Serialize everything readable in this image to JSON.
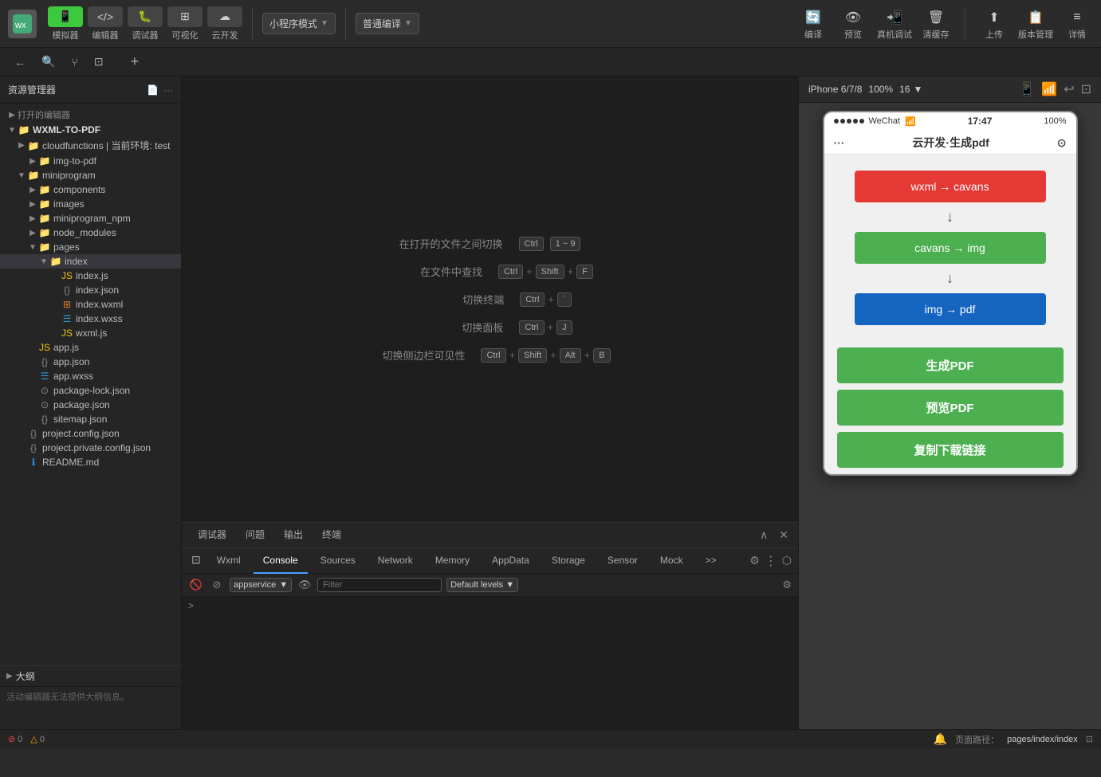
{
  "toolbar": {
    "simulator_label": "模拟器",
    "editor_label": "编辑器",
    "debugger_label": "调试器",
    "visualize_label": "可视化",
    "cloud_label": "云开发",
    "mode_label": "小程序模式",
    "compile_mode_label": "普通编译",
    "compile_btn": "编译",
    "preview_btn": "预览",
    "real_machine_label": "真机调试",
    "clean_cache_label": "清缓存",
    "upload_label": "上传",
    "version_label": "版本管理",
    "detail_label": "详情"
  },
  "sidebar": {
    "title": "资源管理器",
    "recent_label": "打开的编辑器",
    "project_name": "WXML-TO-PDF",
    "items": [
      {
        "name": "cloudfunctions | 当前环境: test",
        "type": "folder",
        "level": 1
      },
      {
        "name": "img-to-pdf",
        "type": "folder",
        "level": 2
      },
      {
        "name": "miniprogram",
        "type": "folder",
        "level": 1
      },
      {
        "name": "components",
        "type": "folder",
        "level": 2
      },
      {
        "name": "images",
        "type": "folder",
        "level": 2
      },
      {
        "name": "miniprogram_npm",
        "type": "folder",
        "level": 2
      },
      {
        "name": "node_modules",
        "type": "folder",
        "level": 2
      },
      {
        "name": "pages",
        "type": "folder",
        "level": 2
      },
      {
        "name": "index",
        "type": "folder",
        "level": 3,
        "active": true
      },
      {
        "name": "index.js",
        "type": "js",
        "level": 4
      },
      {
        "name": "index.json",
        "type": "json",
        "level": 4
      },
      {
        "name": "index.wxml",
        "type": "wxml",
        "level": 4
      },
      {
        "name": "index.wxss",
        "type": "wxss",
        "level": 4
      },
      {
        "name": "wxml.js",
        "type": "js",
        "level": 4
      },
      {
        "name": "app.js",
        "type": "js",
        "level": 2
      },
      {
        "name": "app.json",
        "type": "json",
        "level": 2
      },
      {
        "name": "app.wxss",
        "type": "wxss",
        "level": 2
      },
      {
        "name": "package-lock.json",
        "type": "json",
        "level": 2
      },
      {
        "name": "package.json",
        "type": "json",
        "level": 2
      },
      {
        "name": "sitemap.json",
        "type": "json",
        "level": 2
      },
      {
        "name": "project.config.json",
        "type": "json",
        "level": 1
      },
      {
        "name": "project.private.config.json",
        "type": "json",
        "level": 1
      },
      {
        "name": "README.md",
        "type": "md",
        "level": 1
      }
    ]
  },
  "editor": {
    "hint_title": "",
    "hints": [
      {
        "label": "在打开的文件之间切换",
        "keys": [
          "Ctrl",
          "1 ~ 9"
        ]
      },
      {
        "label": "在文件中查找",
        "keys": [
          "Ctrl",
          "+",
          "Shift",
          "+",
          "F"
        ]
      },
      {
        "label": "切换终端",
        "keys": [
          "Ctrl",
          "+",
          "`"
        ]
      },
      {
        "label": "切换面板",
        "keys": [
          "Ctrl",
          "+",
          "J"
        ]
      },
      {
        "label": "切换侧边栏可见性",
        "keys": [
          "Ctrl",
          "+",
          "Shift",
          "+",
          "Alt",
          "+",
          "B"
        ]
      }
    ]
  },
  "debug": {
    "tabs": [
      "调试器",
      "问题",
      "输出",
      "终端"
    ],
    "active_tab": "Console",
    "sub_tabs": [
      "Wxml",
      "Console",
      "Sources",
      "Network",
      "Memory",
      "AppData",
      "Storage",
      "Sensor",
      "Mock"
    ],
    "more_label": ">>",
    "service": "appservice",
    "filter_placeholder": "Filter",
    "level": "Default levels"
  },
  "phone": {
    "carrier": "WeChat",
    "wifi": "WiFi",
    "time": "17:47",
    "battery": "100%",
    "title": "云开发·生成pdf",
    "btn_wxml": "wxml → cavans",
    "btn_cavans": "cavans → img",
    "btn_img": "img → pdf",
    "btn_generate": "生成PDF",
    "btn_preview": "预览PDF",
    "btn_copy": "复制下载链接"
  },
  "phone_header": {
    "model": "iPhone 6/7/8",
    "zoom": "100%",
    "size": "16"
  },
  "outline": {
    "title": "大纲",
    "empty_msg": "活动编辑器无法提供大纲信息。"
  },
  "status_bar": {
    "errors": "0",
    "warnings": "0",
    "page_path_label": "页面路径：",
    "page_path": "pages/index/index"
  }
}
